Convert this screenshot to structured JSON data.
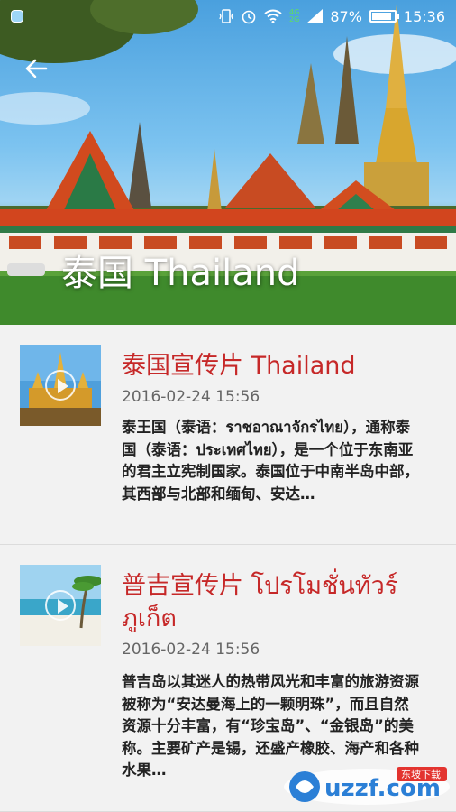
{
  "status_bar": {
    "battery_percent": "87%",
    "time": "15:36",
    "net_top": "4G",
    "net_bottom": "2G",
    "battery_level": 0.87
  },
  "header": {
    "title": "泰国 Thailand"
  },
  "items": [
    {
      "title": "泰国宣传片 Thailand",
      "date": "2016-02-24 15:56",
      "description": "泰王国（泰语：ราชอาณาจักรไทย），通称泰国（泰语：ประเทศไทย），是一个位于东南亚的君主立宪制国家。泰国位于中南半岛中部，其西部与北部和缅甸、安达…"
    },
    {
      "title": "普吉宣传片 โปรโมชั่นทัวร์ภูเก็ต",
      "date": "2016-02-24 15:56",
      "description": "普吉岛以其迷人的热带风光和丰富的旅游资源被称为“安达曼海上的一颗明珠”，而且自然资源十分丰富，有“珍宝岛”、“金银岛”的美称。主要矿产是锡，还盛产橡胶、海产和各种水果…"
    }
  ],
  "watermark": {
    "text": "uzzf.com",
    "tag": "东坡下载"
  },
  "colors": {
    "accent_red": "#c62828",
    "date_gray": "#666666",
    "background": "#f2f2f2"
  }
}
